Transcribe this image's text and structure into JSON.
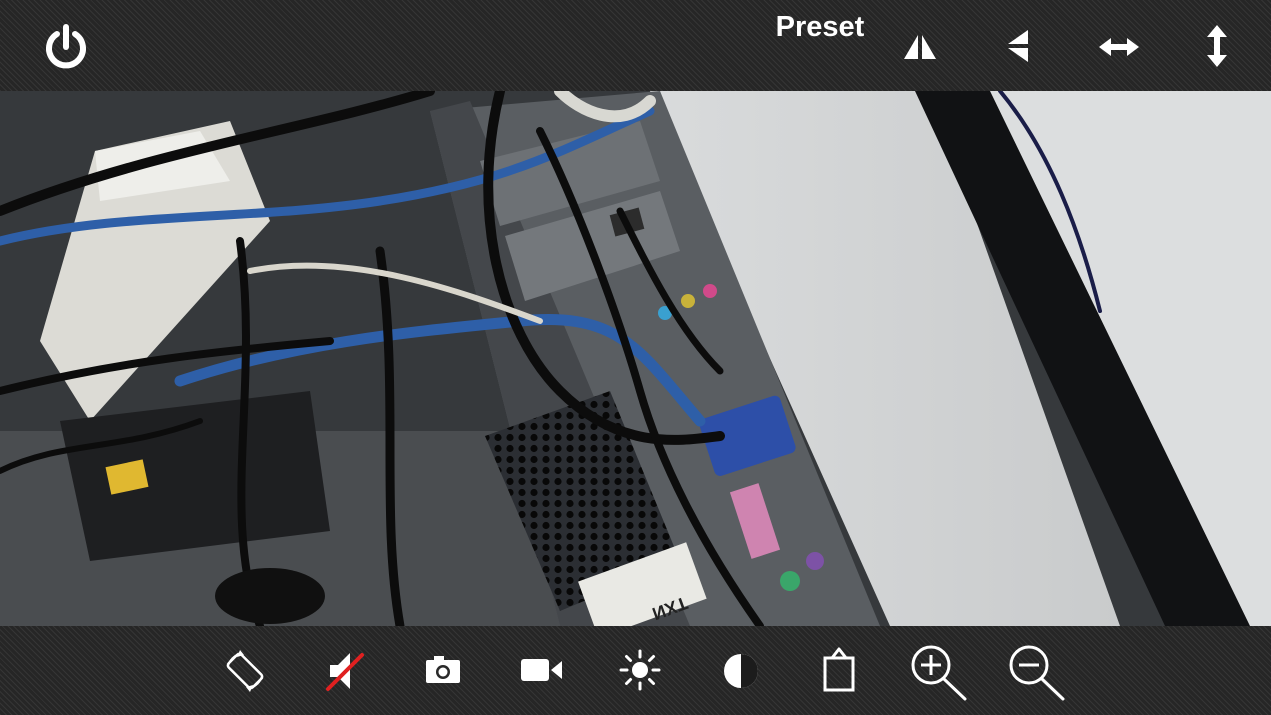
{
  "top_bar": {
    "power_icon": "power-icon",
    "preset_label": "Preset",
    "controls": [
      "mirror-icon",
      "flip-icon",
      "horizontal-swing-icon",
      "vertical-swing-icon"
    ]
  },
  "video": {
    "sticker_text": "NXT",
    "stream_icon": "camera-feed"
  },
  "bottom_bar": {
    "controls": [
      "rotate-icon",
      "mute-icon",
      "snapshot-icon",
      "record-icon",
      "brightness-icon",
      "contrast-icon",
      "share-icon",
      "zoom-in-icon",
      "zoom-out-icon"
    ]
  },
  "colors": {
    "bar_bg": "#2c2c2c",
    "icon": "#ffffff",
    "mute_slash": "#e02020"
  }
}
